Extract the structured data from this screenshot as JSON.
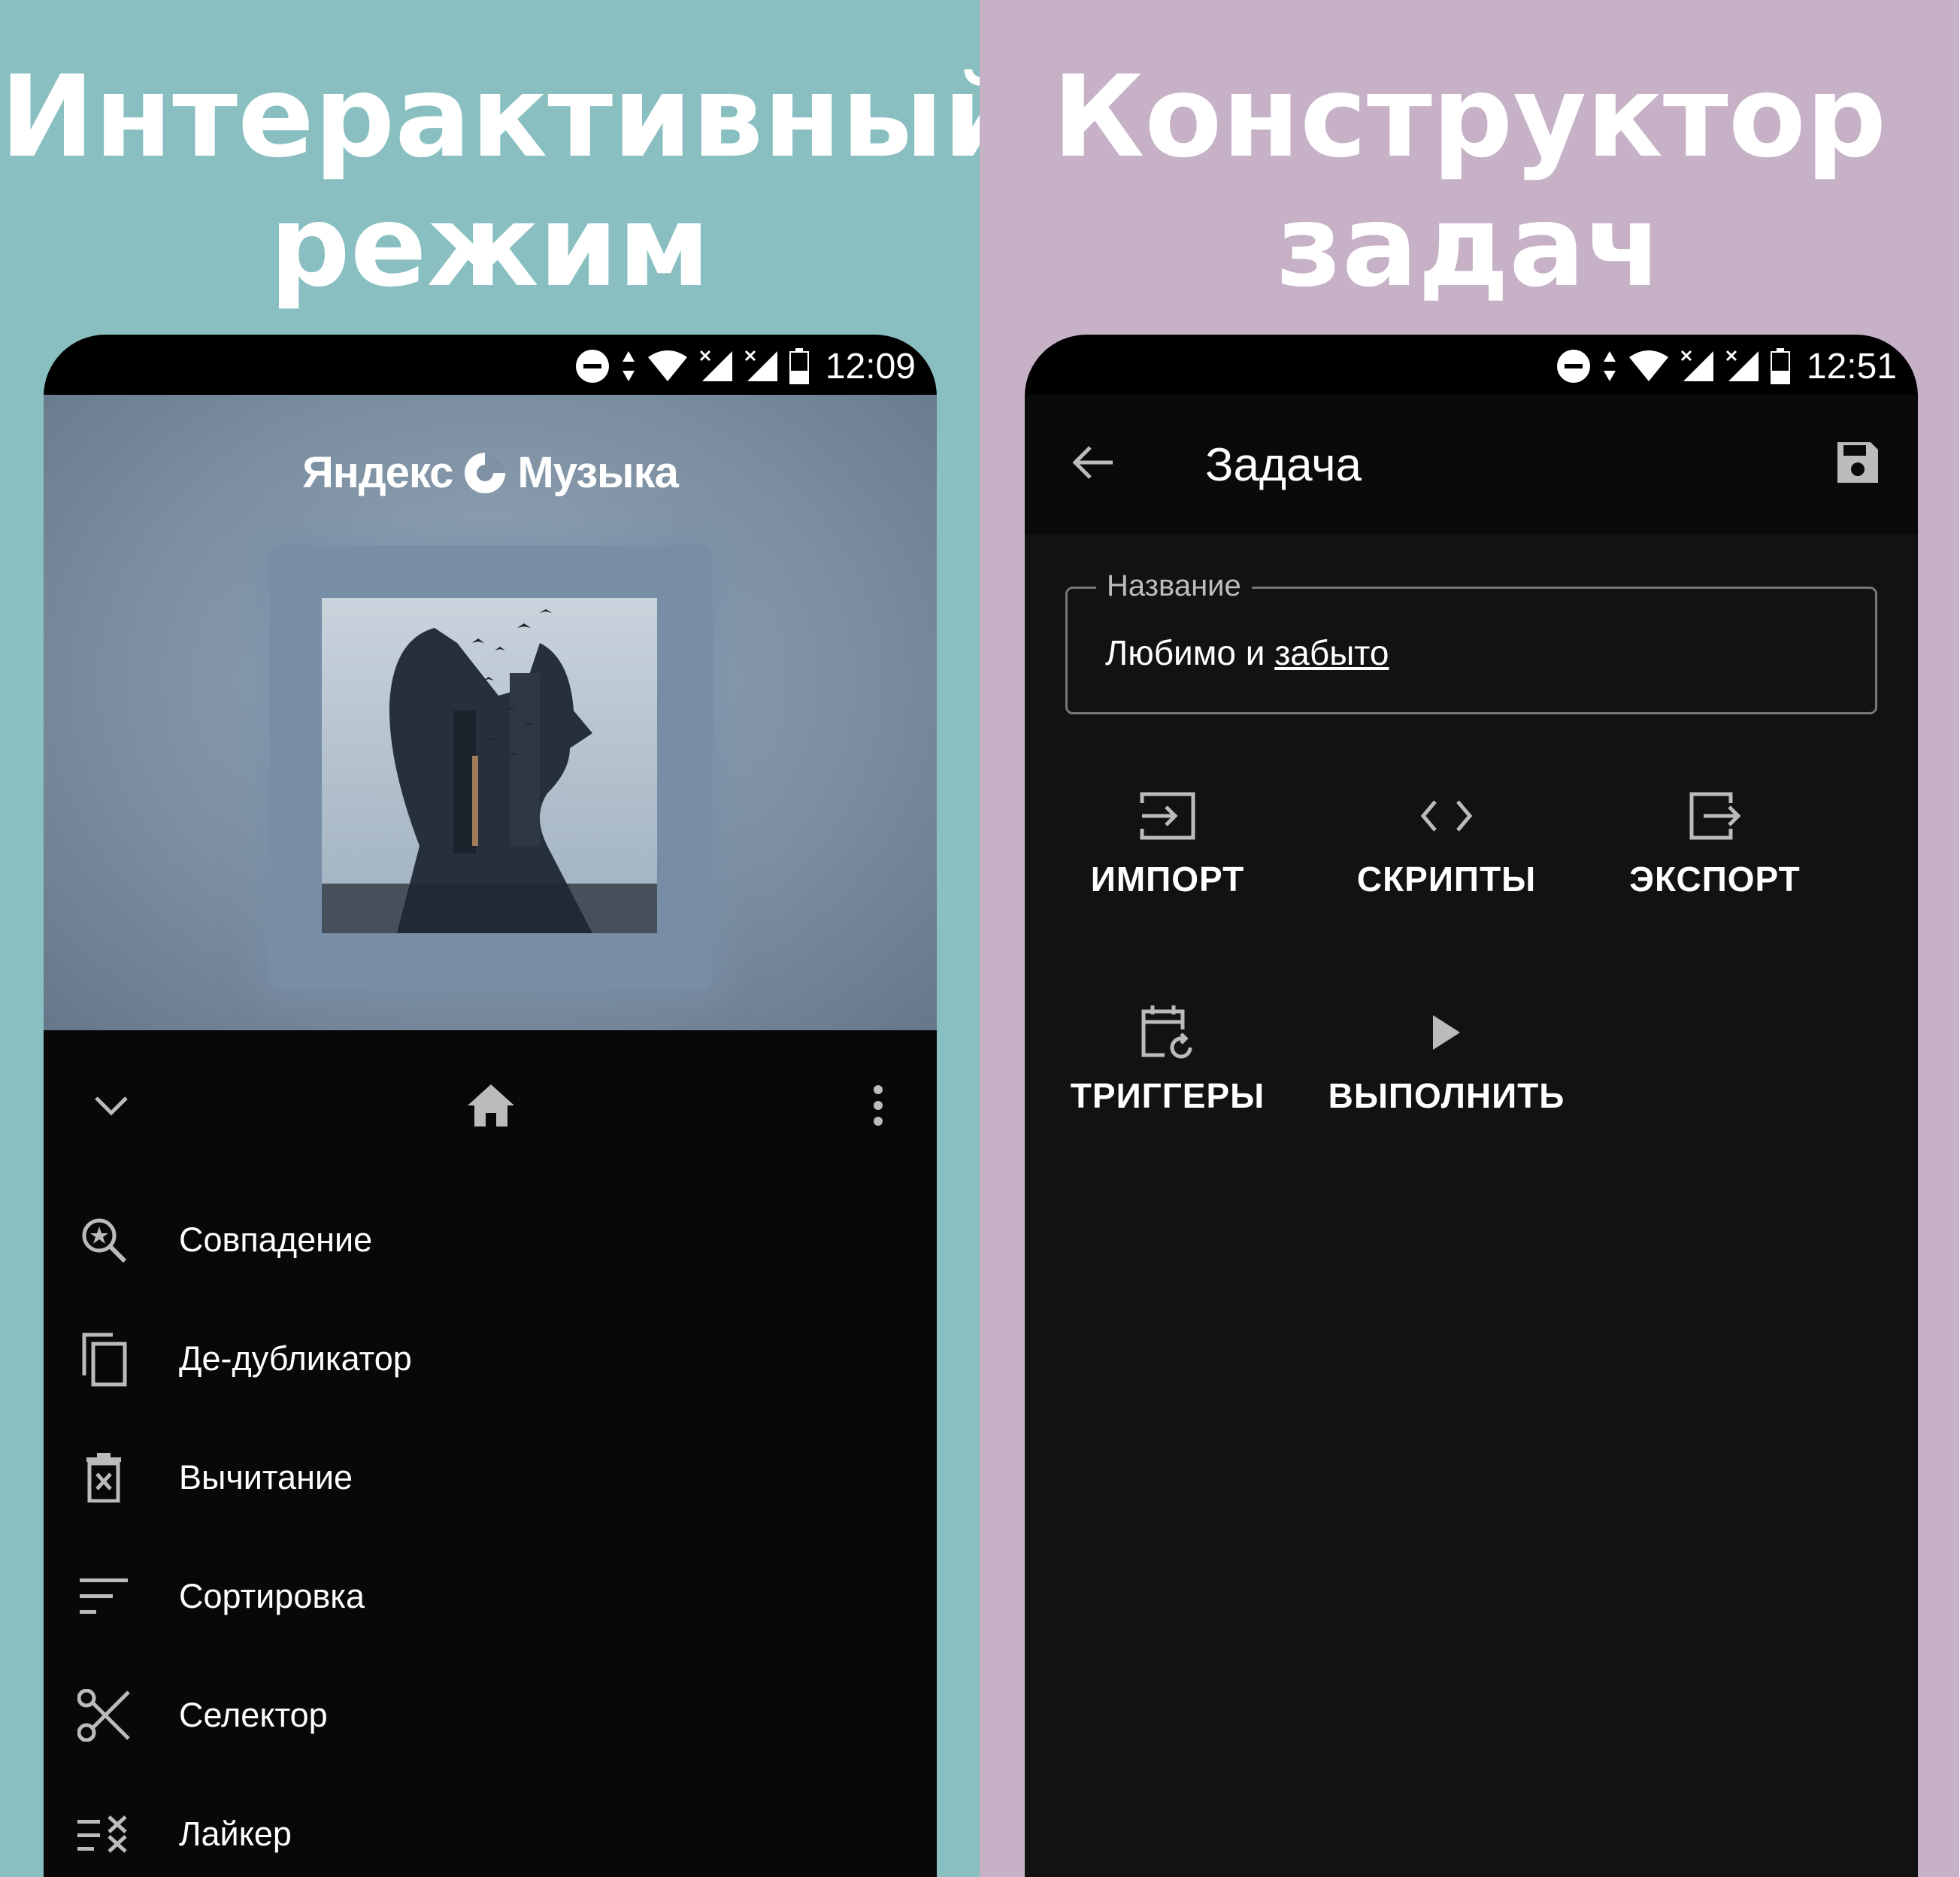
{
  "left": {
    "headline": [
      "Интерактивный",
      "режим"
    ],
    "status_time": "12:09",
    "brand": {
      "name_a": "Яндекс",
      "name_b": "Музыка"
    },
    "menu": [
      {
        "label": "Совпадение",
        "icon": "search-star-icon"
      },
      {
        "label": "Де-дубликатор",
        "icon": "copy-icon"
      },
      {
        "label": "Вычитание",
        "icon": "trash-x-icon"
      },
      {
        "label": "Сортировка",
        "icon": "sort-icon"
      },
      {
        "label": "Селектор",
        "icon": "scissors-icon"
      },
      {
        "label": "Лайкер",
        "icon": "list-remove-icon"
      }
    ]
  },
  "right": {
    "headline": [
      "Конструктор",
      "задач"
    ],
    "status_time": "12:51",
    "toolbar_title": "Задача",
    "field": {
      "label": "Название",
      "value_a": "Любимо и ",
      "value_b": "забыто"
    },
    "actions": [
      {
        "label": "ИМПОРТ",
        "icon": "import-icon"
      },
      {
        "label": "СКРИПТЫ",
        "icon": "code-icon"
      },
      {
        "label": "ЭКСПОРТ",
        "icon": "export-icon"
      },
      {
        "label": "ТРИГГЕРЫ",
        "icon": "calendar-repeat-icon"
      },
      {
        "label": "ВЫПОЛНИТЬ",
        "icon": "play-icon"
      }
    ]
  }
}
